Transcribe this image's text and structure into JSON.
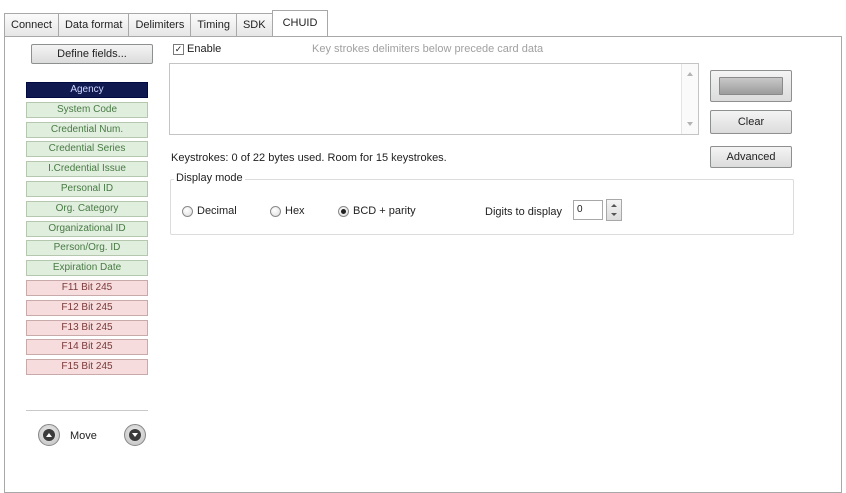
{
  "tabs": [
    {
      "label": "Connect",
      "active": false
    },
    {
      "label": "Data format",
      "active": false
    },
    {
      "label": "Delimiters",
      "active": false
    },
    {
      "label": "Timing",
      "active": false
    },
    {
      "label": "SDK",
      "active": false
    },
    {
      "label": "CHUID",
      "active": true
    }
  ],
  "left": {
    "define_fields_label": "Define fields...",
    "fields": [
      {
        "label": "Agency",
        "state": "selected"
      },
      {
        "label": "System Code",
        "state": "green"
      },
      {
        "label": "Credential Num.",
        "state": "green"
      },
      {
        "label": "Credential Series",
        "state": "green"
      },
      {
        "label": "I.Credential Issue",
        "state": "green"
      },
      {
        "label": "Personal ID",
        "state": "green"
      },
      {
        "label": "Org. Category",
        "state": "green"
      },
      {
        "label": "Organizational ID",
        "state": "green"
      },
      {
        "label": "Person/Org. ID",
        "state": "green"
      },
      {
        "label": "Expiration Date",
        "state": "green"
      },
      {
        "label": "F11 Bit 245",
        "state": "pink"
      },
      {
        "label": "F12 Bit 245",
        "state": "pink"
      },
      {
        "label": "F13 Bit 245",
        "state": "pink"
      },
      {
        "label": "F14 Bit 245",
        "state": "pink"
      },
      {
        "label": "F15 Bit 245",
        "state": "pink"
      }
    ],
    "move_label": "Move"
  },
  "main": {
    "enable_label": "Enable",
    "enable_checked": true,
    "hint": "Key strokes delimiters below precede card data",
    "keystroke_value": "",
    "keystrokes_status": "Keystrokes: 0 of 22 bytes used. Room for 15 keystrokes.",
    "clear_label": "Clear",
    "advanced_label": "Advanced",
    "display_mode_label": "Display mode",
    "radios": [
      {
        "label": "Decimal",
        "selected": false
      },
      {
        "label": "Hex",
        "selected": false
      },
      {
        "label": "BCD + parity",
        "selected": true
      }
    ],
    "digits_label": "Digits to display",
    "digits_value": "0"
  },
  "colors": {
    "selected_field_bg": "#101a50",
    "green_field_bg": "#dfeedd",
    "pink_field_bg": "#f6dcdc"
  }
}
